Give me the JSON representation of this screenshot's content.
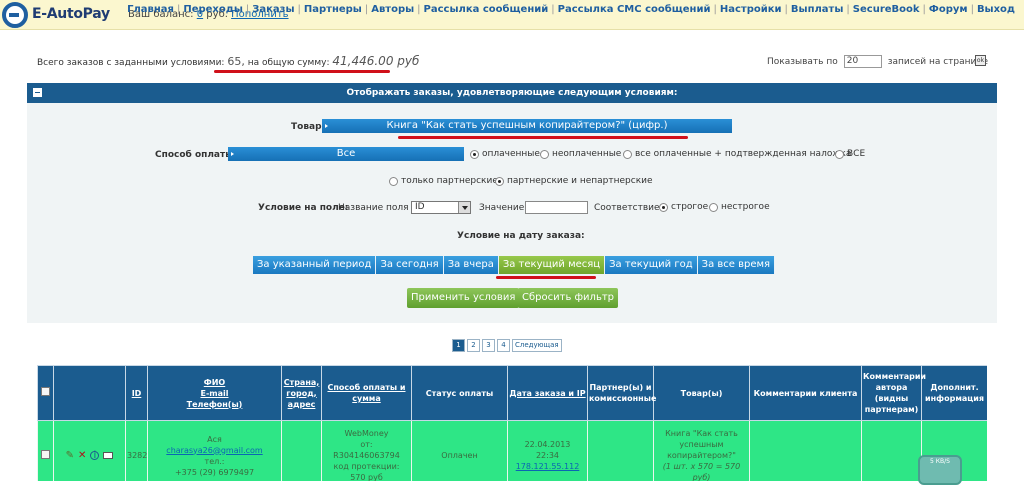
{
  "header": {
    "logo_text": "E-AutoPay",
    "balance_label": "Ваш баланс:",
    "balance_value": "0",
    "balance_currency": "руб.",
    "refill_link": "Пополнить",
    "nav": [
      "Главная",
      "Переходы",
      "Заказы",
      "Партнеры",
      "Авторы",
      "Рассылка сообщений",
      "Рассылка СМС сообщений",
      "Настройки",
      "Выплаты",
      "SecureBook",
      "Форум",
      "Выход"
    ]
  },
  "summary": {
    "label": "Всего заказов с заданными условиями:",
    "count": "65,",
    "sum_label": "на общую сумму:",
    "sum_value": "41,446.00 руб"
  },
  "perpage": {
    "prefix": "Показывать по",
    "value": "20",
    "suffix": "записей на странице",
    "ok": "ok"
  },
  "filter": {
    "title": "Отображать заказы, удовлетворяющие следующим условиям:",
    "product_label": "Товар:",
    "product_value": "Книга \"Как стать успешным копирайтером?\" (цифр.)",
    "payment_label": "Способ оплаты:",
    "payment_value": "Все",
    "payment_status_options": [
      "оплаченные",
      "неоплаченные",
      "все оплаченные + подтвержденная наложка",
      "ВСЕ"
    ],
    "partner_options": [
      "только партнерские",
      "партнерские и непартнерские"
    ],
    "field_condition_label": "Условие на поле:",
    "field_name_label": "Название поля",
    "field_name_value": "ID",
    "value_label": "Значение",
    "match_label": "Соответствие:",
    "match_options": [
      "строгое",
      "нестрогое"
    ],
    "date_condition_label": "Условие на дату заказа:",
    "periods": [
      "За указанный период",
      "За сегодня",
      "За вчера",
      "За текущий месяц",
      "За текущий год",
      "За все время"
    ],
    "apply_button": "Применить условия",
    "reset_button": "Сбросить фильтр"
  },
  "pager": {
    "pages": [
      "1",
      "2",
      "3",
      "4"
    ],
    "current": "1",
    "next": "Следующая"
  },
  "table": {
    "headers": {
      "id": "ID",
      "fio": "ФИО",
      "email": "E-mail",
      "phone": "Телефон(ы)",
      "location_1": "Страна,",
      "location_2": "город,",
      "location_3": "адрес",
      "payment": "Способ оплаты и сумма",
      "status": "Статус оплаты",
      "date_1": "Дата заказа и IP",
      "partner": "Партнер(ы) и комиссионные",
      "product": "Товар(ы)",
      "client_comment": "Комментарии клиента",
      "author_comment_1": "Комментарии",
      "author_comment_2": "автора",
      "author_comment_3": "(видны",
      "author_comment_4": "партнерам)",
      "extra": "Дополнит. информация"
    },
    "row": {
      "id": "3282",
      "name": "Ася",
      "email": "charasya26@gmail.com",
      "phone_label": "тел.:",
      "phone": "+375 (29) 6979497",
      "pay_method": "WebMoney",
      "pay_from": "от:",
      "pay_account": "R304146063794",
      "pay_code": "код протекции:",
      "pay_amount": "570 руб",
      "status": "Оплачен",
      "date": "22.04.2013",
      "time": "22:34",
      "ip": "178.121.55.112",
      "product": "Книга \"Как стать успешным копирайтером?\"",
      "product_qty": "(1 шт. x 570 = 570 руб)"
    }
  },
  "widget": {
    "label": "5 КВ/S"
  }
}
